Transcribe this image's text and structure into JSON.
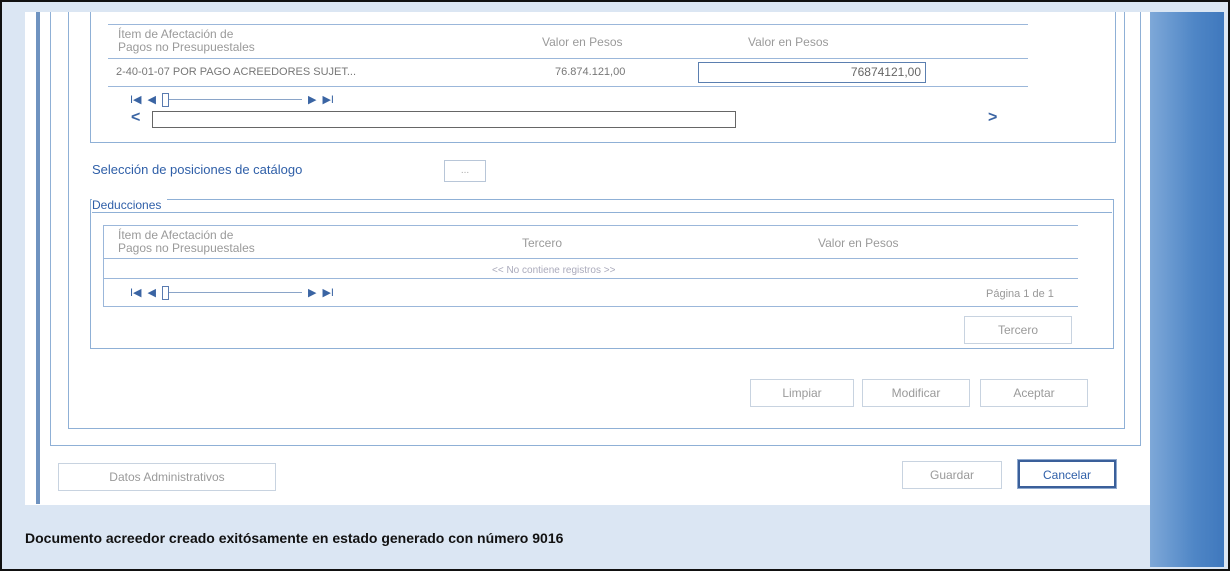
{
  "table1": {
    "headers": [
      "Ítem de Afectación de\nPagos no Presupuestales",
      "Valor en Pesos",
      "Valor en Pesos"
    ],
    "rows": [
      {
        "item": "2-40-01-07 POR PAGO ACREEDORES SUJET...",
        "valor": "76.874.121,00",
        "input": "76874121,00"
      }
    ]
  },
  "pager": {
    "first": "I◀",
    "prev": "◀",
    "next": "▶",
    "last": "▶I"
  },
  "catalog_label": "Selección de posiciones de catálogo",
  "catalog_button": "...",
  "deducciones": {
    "title": "Deducciones",
    "headers": [
      "Ítem de Afectación de\nPagos no Presupuestales",
      "Tercero",
      "Valor en Pesos"
    ],
    "empty_text": "<< No contiene registros >>",
    "page_info": "Página 1 de 1",
    "tercero_button": "Tercero"
  },
  "actions": {
    "limpiar": "Limpiar",
    "modificar": "Modificar",
    "aceptar": "Aceptar"
  },
  "footer": {
    "datos_admin": "Datos Administrativos",
    "guardar": "Guardar",
    "cancelar": "Cancelar"
  },
  "status_message": "Documento acreedor creado exitósamente en estado generado con número 9016"
}
